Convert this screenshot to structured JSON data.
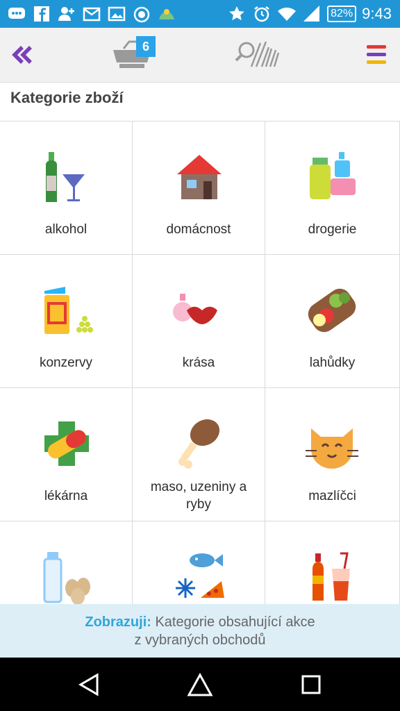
{
  "status_bar": {
    "time": "9:43",
    "battery": "82%",
    "left_icons": [
      "chat-icon",
      "facebook-icon",
      "add-contact-icon",
      "gmail-icon",
      "gallery-icon",
      "alarm-app-icon",
      "weather-icon"
    ],
    "right_icons": [
      "star-icon",
      "alarm-icon",
      "wifi-icon",
      "signal-icon"
    ]
  },
  "toolbar": {
    "cart_badge": "6",
    "icons": [
      "back-double-chevron-icon",
      "basket-icon",
      "search-barcode-icon",
      "menu-icon"
    ],
    "menu_colors": [
      "#e53935",
      "#7b3fb8",
      "#f4b400"
    ]
  },
  "section": {
    "title": "Kategorie zboží"
  },
  "categories": [
    {
      "label": "alkohol",
      "icon": "wine-icon"
    },
    {
      "label": "domácnost",
      "icon": "house-icon"
    },
    {
      "label": "drogerie",
      "icon": "cosmetics-icon"
    },
    {
      "label": "konzervy",
      "icon": "can-icon"
    },
    {
      "label": "krása",
      "icon": "lips-perfume-icon"
    },
    {
      "label": "lahůdky",
      "icon": "sandwich-icon"
    },
    {
      "label": "lékárna",
      "icon": "pharmacy-icon"
    },
    {
      "label": "maso, uzeniny a ryby",
      "icon": "meat-icon"
    },
    {
      "label": "mazlíčci",
      "icon": "cat-icon"
    },
    {
      "label": "",
      "icon": "milk-eggs-icon"
    },
    {
      "label": "",
      "icon": "frozen-food-icon"
    },
    {
      "label": "",
      "icon": "drinks-icon"
    }
  ],
  "info": {
    "prefix": "Zobrazuji:",
    "line1": "Kategorie obsahující akce",
    "line2": "z vybraných obchodů"
  },
  "nav": {
    "icons": [
      "back-icon",
      "home-icon",
      "recents-icon"
    ]
  }
}
